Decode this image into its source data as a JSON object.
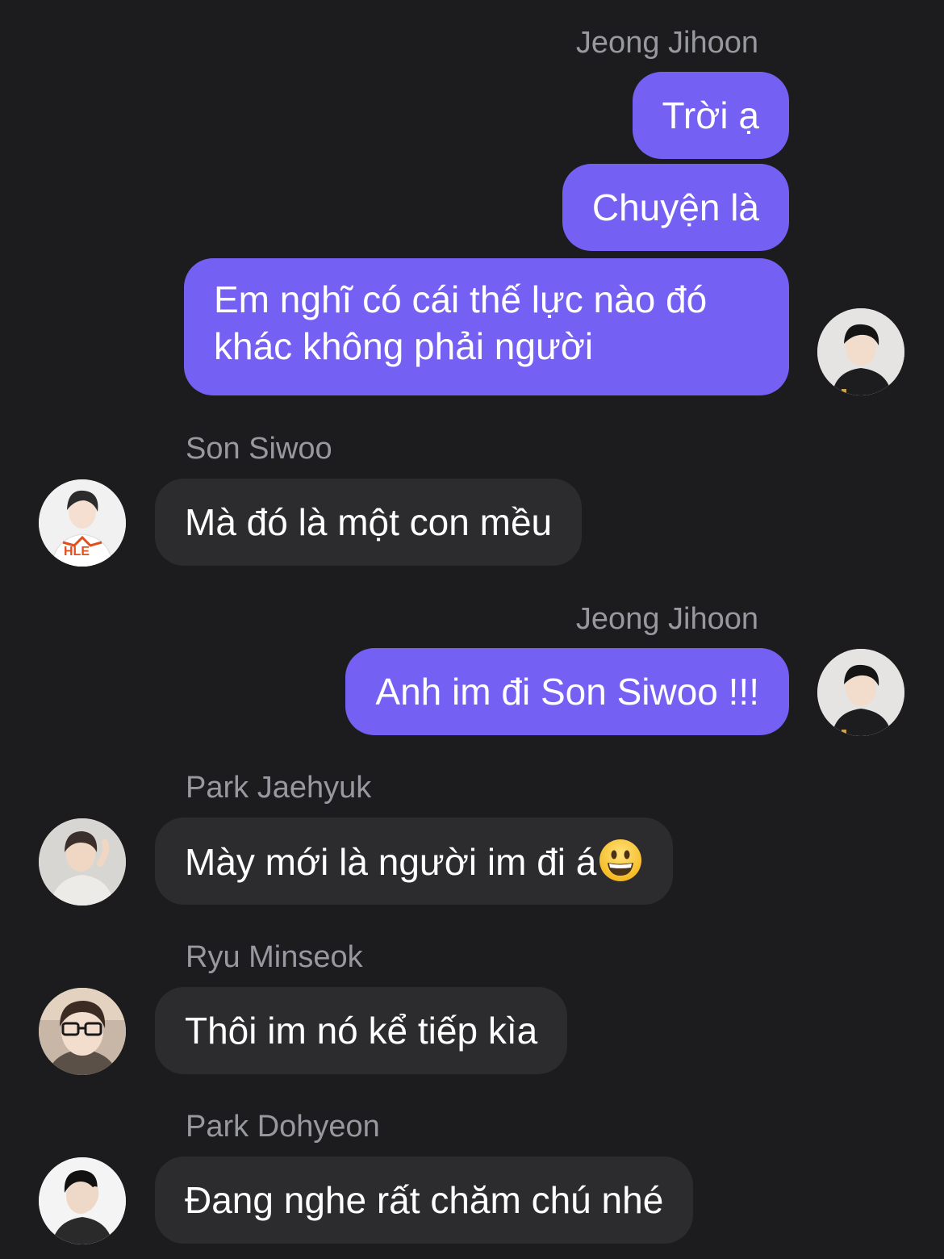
{
  "messages": [
    {
      "sender": "Jeong Jihoon",
      "text": "Trời ạ",
      "direction": "outgoing"
    },
    {
      "text": "Chuyện là",
      "direction": "outgoing"
    },
    {
      "text": "Em nghĩ có cái thế lực nào đó khác không phải người",
      "direction": "outgoing"
    },
    {
      "sender": "Son Siwoo",
      "text": "Mà đó là một con mều",
      "direction": "incoming"
    },
    {
      "sender": "Jeong Jihoon",
      "text": "Anh im đi Son Siwoo !!!",
      "direction": "outgoing"
    },
    {
      "sender": "Park Jaehyuk",
      "text": "Mày mới là người im đi á",
      "emoji": "grinning-face-emoji",
      "direction": "incoming"
    },
    {
      "sender": "Ryu Minseok",
      "text": "Thôi im nó kể tiếp kìa",
      "direction": "incoming"
    },
    {
      "sender": "Park Dohyeon",
      "text": "Đang nghe rất chăm chú nhé",
      "direction": "incoming"
    }
  ],
  "avatar_jihoon_top": {
    "name": "Jeong Jihoon"
  },
  "avatar_siwoo": {
    "name": "Son Siwoo",
    "jersey_text": "HLE"
  },
  "avatar_jihoon_mid": {
    "name": "Jeong Jihoon"
  },
  "avatar_jaehyuk": {
    "name": "Park Jaehyuk"
  },
  "avatar_minseok": {
    "name": "Ryu Minseok"
  },
  "avatar_dohyeon": {
    "name": "Park Dohyeon"
  },
  "colors": {
    "background": "#1c1c1e",
    "outgoing_bubble": "#7460f2",
    "incoming_bubble": "#2c2c2e",
    "sender_name": "#98989f",
    "message_text": "#ffffff"
  }
}
